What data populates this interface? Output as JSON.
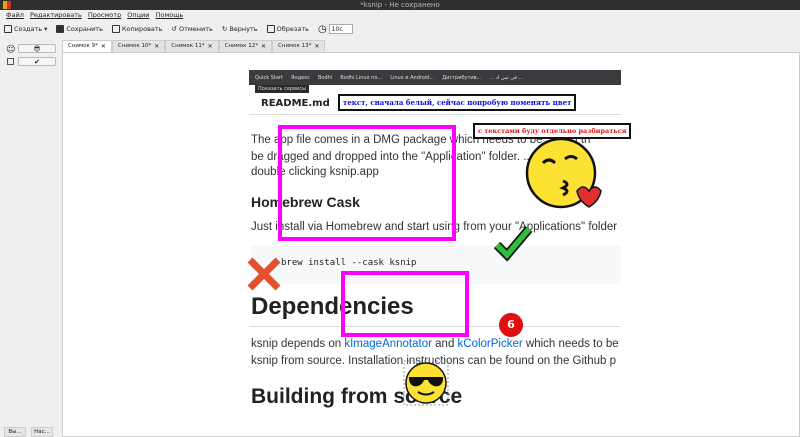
{
  "window": {
    "title": "*ksnip - Не сохранено"
  },
  "menu": [
    "Файл",
    "Редактировать",
    "Просмотр",
    "Опции",
    "Помощь"
  ],
  "toolbar": {
    "new": "Создать",
    "save": "Сохранить",
    "copy": "Копировать",
    "undo": "Отменить",
    "redo": "Вернуть",
    "crop": "Обрезать",
    "delay": "10c"
  },
  "left_panel": {
    "bottom_tabs": [
      "Вы...",
      "Нас..."
    ]
  },
  "tabs": [
    "Снимок 9*",
    "Снимок 10*",
    "Снимок 11*",
    "Снимок 12*",
    "Снимок 13*"
  ],
  "screenshot": {
    "bookmarks": [
      "Quick Start",
      "Яндекс",
      "Bodhi",
      "Bodhi Linux по...",
      "Linux и Android...",
      "Дистрибутив...",
      "... في تس اذ ..."
    ],
    "tooltip": "Показать сервисы",
    "readme_title": "README.md",
    "para1": [
      "The app file comes in a DMG package which needs to be ... and th",
      "be dragged and dropped into the \"Application\" folder. ... app",
      "double clicking ksnip.app"
    ],
    "h_homebrew": "Homebrew Cask",
    "para2": "Just install via Homebrew and start using from your \"Applications\" folder",
    "code": "brew install --cask ksnip",
    "h_dependencies": "Dependencies",
    "dep_prefix": "ksnip depends on ",
    "dep_link1": "kImageAnnotator",
    "dep_and": " and ",
    "dep_link2": "kColorPicker",
    "dep_suffix": " which needs to be",
    "dep_line2": "ksnip from source. Installation instructions can be found on the Github p",
    "h_building": "Building from source"
  },
  "annotations": {
    "text_blue": "текст, сначала белый, сейчас попробую поменять цвет",
    "text_red": "с текстами буду отдельно разбираться",
    "number_badge": "6",
    "colors": {
      "rect": "#ff00ff",
      "blue": "#1010e0",
      "red": "#e01010",
      "badge": "#e01010"
    }
  }
}
